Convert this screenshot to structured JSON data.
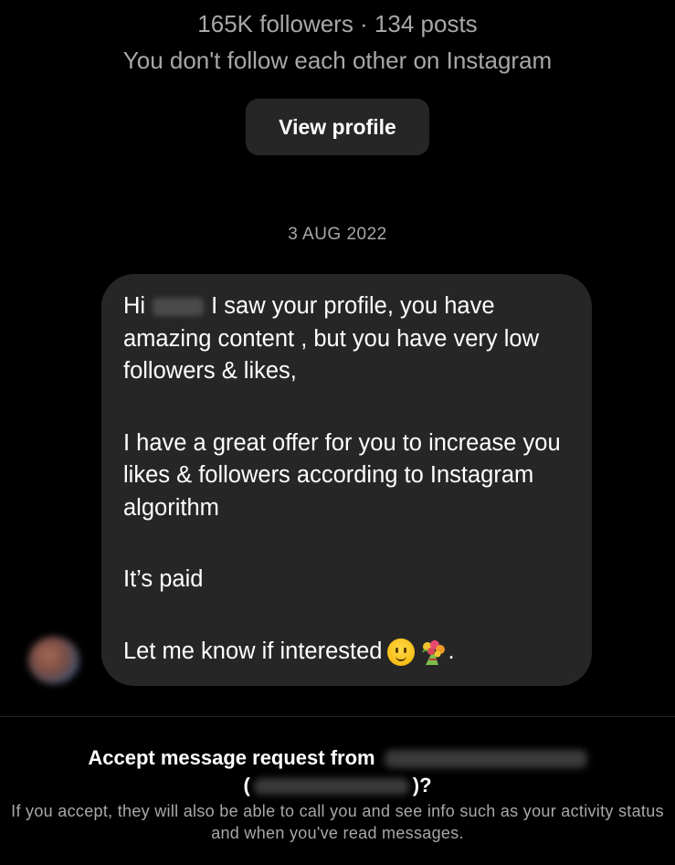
{
  "profile": {
    "stats": "165K followers · 134 posts",
    "follow_status": "You don't follow each other on Instagram",
    "view_profile_label": "View profile"
  },
  "thread": {
    "date": "3 AUG 2022",
    "message": {
      "greeting": "Hi",
      "line1_rest": "I saw your profile, you have amazing content , but you have very low followers & likes,",
      "para2": "I have a great offer for you to increase you likes & followers according to Instagram algorithm",
      "para3": "It’s paid",
      "para4": "Let me know if interested",
      "para4_end": "."
    }
  },
  "request": {
    "title": "Accept message request from",
    "open_paren": "(",
    "close_paren": ")?",
    "description": "If you accept, they will also be able to call you and see info such as your activity status and when you've read messages."
  },
  "icons": {
    "smile": "slightly-smiling-face-icon",
    "bouquet": "bouquet-icon"
  },
  "colors": {
    "background": "#000000",
    "bubble": "#262626",
    "secondary_text": "#a8a8a8"
  }
}
